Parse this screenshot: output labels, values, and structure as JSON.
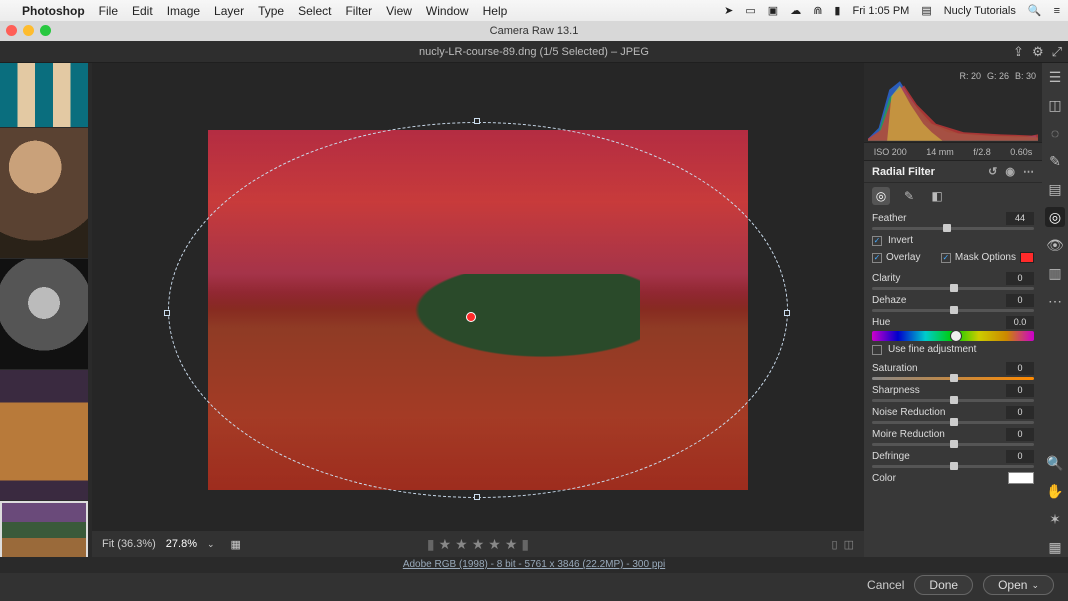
{
  "menubar": {
    "app": "Photoshop",
    "items": [
      "File",
      "Edit",
      "Image",
      "Layer",
      "Type",
      "Select",
      "Filter",
      "View",
      "Window",
      "Help"
    ],
    "clock": "Fri 1:05 PM",
    "account": "Nucly Tutorials"
  },
  "window": {
    "title": "Camera Raw 13.1"
  },
  "document": {
    "title": "nucly-LR-course-89.dng (1/5 Selected)  –  JPEG"
  },
  "histogram": {
    "r": "R: 20",
    "g": "G: 26",
    "b": "B: 30"
  },
  "exif": {
    "iso": "ISO 200",
    "focal": "14 mm",
    "aperture": "f/2.8",
    "shutter": "0.60s"
  },
  "panel": {
    "title": "Radial Filter",
    "undo_icon": "↺",
    "eye_icon": "◉",
    "more_icon": "⋯",
    "modes": {
      "new": "◎",
      "brush": "✎",
      "erase": "◧"
    },
    "feather_label": "Feather",
    "feather_value": "44",
    "invert_label": "Invert",
    "overlay_label": "Overlay",
    "mask_options_label": "Mask Options",
    "sliders": {
      "clarity": {
        "label": "Clarity",
        "value": "0"
      },
      "dehaze": {
        "label": "Dehaze",
        "value": "0"
      },
      "hue": {
        "label": "Hue",
        "value": "0.0"
      },
      "fine_adj": {
        "label": "Use fine adjustment"
      },
      "saturation": {
        "label": "Saturation",
        "value": "0"
      },
      "sharpness": {
        "label": "Sharpness",
        "value": "0"
      },
      "noise": {
        "label": "Noise Reduction",
        "value": "0"
      },
      "moire": {
        "label": "Moire Reduction",
        "value": "0"
      },
      "defringe": {
        "label": "Defringe",
        "value": "0"
      },
      "color": {
        "label": "Color"
      }
    }
  },
  "zoom": {
    "fit": "Fit (36.3%)",
    "pct": "27.8%"
  },
  "meta_line": "Adobe RGB (1998) - 8 bit - 5761 x 3846 (22.2MP) - 300 ppi",
  "actions": {
    "cancel": "Cancel",
    "done": "Done",
    "open": "Open"
  },
  "chart_data": {
    "type": "area",
    "title": "Histogram",
    "xlabel": "",
    "ylabel": "",
    "xlim": [
      0,
      255
    ],
    "series": [
      {
        "name": "Red",
        "values": [
          5,
          20,
          70,
          90,
          60,
          35,
          20,
          10,
          8,
          8,
          8,
          6,
          5,
          5,
          4,
          4,
          10
        ]
      },
      {
        "name": "Green",
        "values": [
          3,
          15,
          55,
          80,
          55,
          30,
          18,
          10,
          8,
          7,
          7,
          6,
          5,
          5,
          4,
          4,
          8
        ]
      },
      {
        "name": "Blue",
        "values": [
          8,
          40,
          95,
          98,
          65,
          30,
          15,
          8,
          6,
          5,
          5,
          4,
          4,
          4,
          3,
          3,
          5
        ]
      }
    ]
  }
}
